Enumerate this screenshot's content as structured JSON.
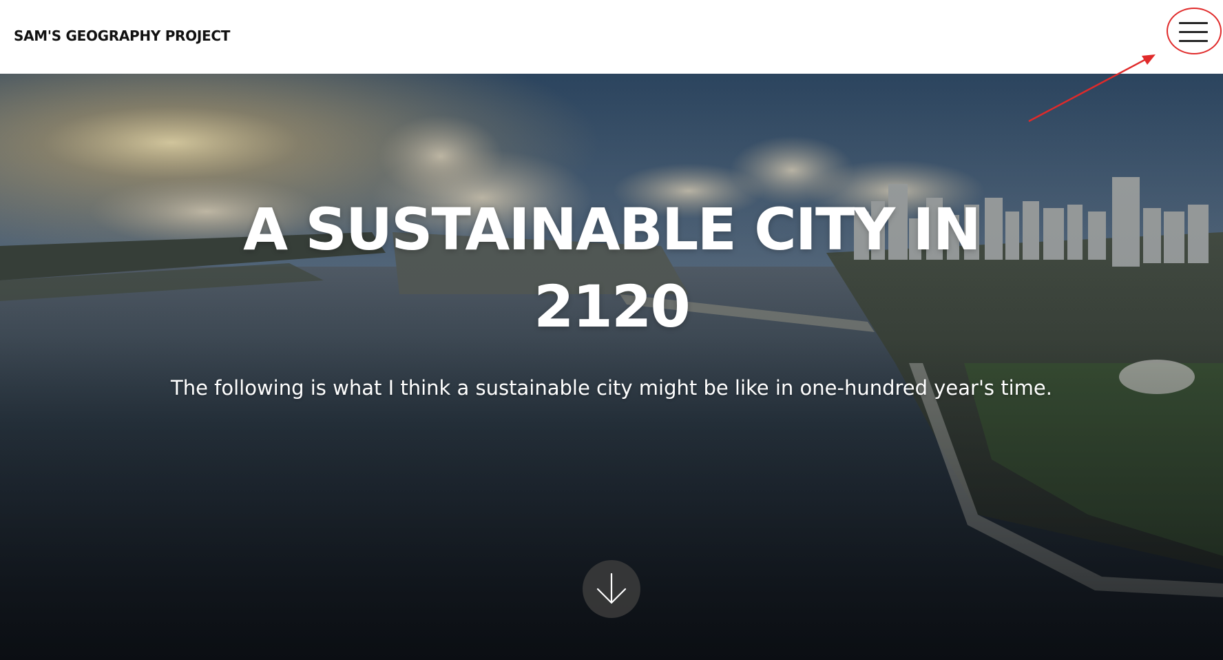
{
  "header": {
    "site_title": "SAM'S GEOGRAPHY PROJECT",
    "menu_icon": "hamburger-menu-icon"
  },
  "hero": {
    "title": "A SUSTAINABLE CITY IN 2120",
    "subtitle": "The following is what I think a sustainable city might be like in one-hundred year's time.",
    "scroll_icon": "arrow-down-icon"
  },
  "annotation": {
    "color": "#e02a2a"
  }
}
